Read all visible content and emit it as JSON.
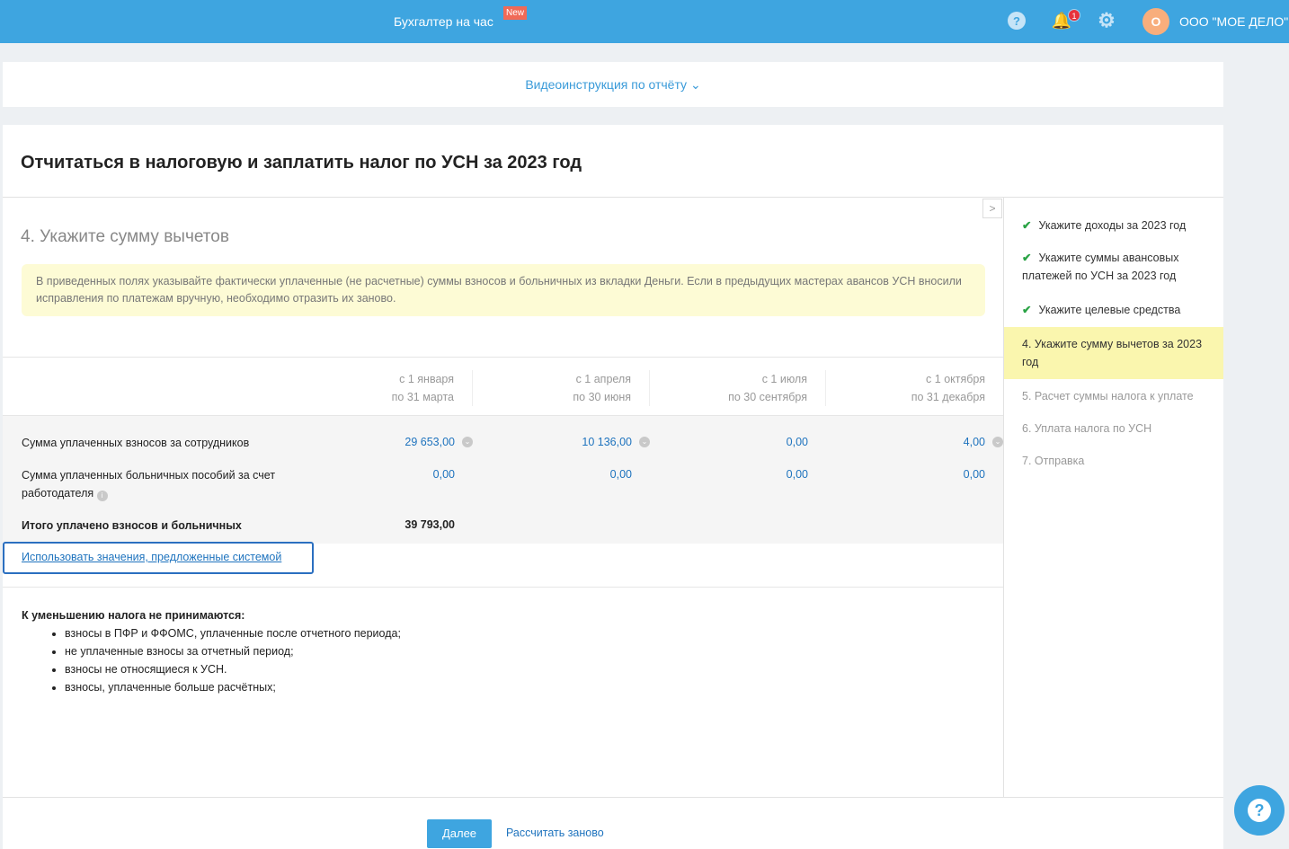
{
  "header": {
    "brand": "Бухгалтер на час",
    "new_badge": "New",
    "notif_count": "1",
    "avatar_letter": "О",
    "org": "ООО \"МОЕ ДЕЛО\""
  },
  "video_link": "Видеоинструкция по отчёту",
  "title": "Отчитаться в налоговую и заплатить налог по УСН за 2023 год",
  "step_title": "4. Укажите сумму вычетов",
  "note": "В приведенных полях указывайте фактически уплаченные (не расчетные) суммы взносов и больничных из вкладки Деньги. Если в предыдущих мастерах авансов УСН вносили исправления по платежам вручную, необходимо отразить их заново.",
  "columns": [
    [
      "с 1 января",
      "по 31 марта"
    ],
    [
      "с 1 апреля",
      "по 30 июня"
    ],
    [
      "с 1 июля",
      "по 30 сентября"
    ],
    [
      "с 1 октября",
      "по 31 декабря"
    ]
  ],
  "rows": [
    {
      "label": "Сумма уплаченных взносов за сотрудников",
      "values": [
        "29 653,00",
        "10 136,00",
        "0,00",
        "4,00"
      ]
    },
    {
      "label": "Сумма уплаченных больничных пособий за счет работодателя",
      "values": [
        "0,00",
        "0,00",
        "0,00",
        "0,00"
      ]
    }
  ],
  "total": {
    "label": "Итого уплачено взносов и больничных",
    "value": "39 793,00"
  },
  "use_system_link": "Использовать значения, предложенные системой",
  "exclusions": {
    "title": "К уменьшению налога не принимаются:",
    "items": [
      "взносы в ПФР и ФФОМС, уплаченные после отчетного периода;",
      "не уплаченные взносы за отчетный период;",
      "взносы не относящиеся к УСН.",
      "взносы, уплаченные больше расчётных;"
    ]
  },
  "steps": [
    {
      "label": "Укажите доходы за 2023 год",
      "state": "done"
    },
    {
      "label": "Укажите суммы авансовых платежей по УСН за 2023 год",
      "state": "done"
    },
    {
      "label": "Укажите целевые средства",
      "state": "done"
    },
    {
      "label": "4.  Укажите сумму вычетов за 2023 год",
      "state": "current"
    },
    {
      "label": "5.  Расчет суммы налога к уплате",
      "state": "todo"
    },
    {
      "label": "6.  Уплата налога по УСН",
      "state": "todo"
    },
    {
      "label": "7.  Отправка",
      "state": "todo"
    }
  ],
  "buttons": {
    "next": "Далее",
    "recalc": "Рассчитать заново"
  }
}
